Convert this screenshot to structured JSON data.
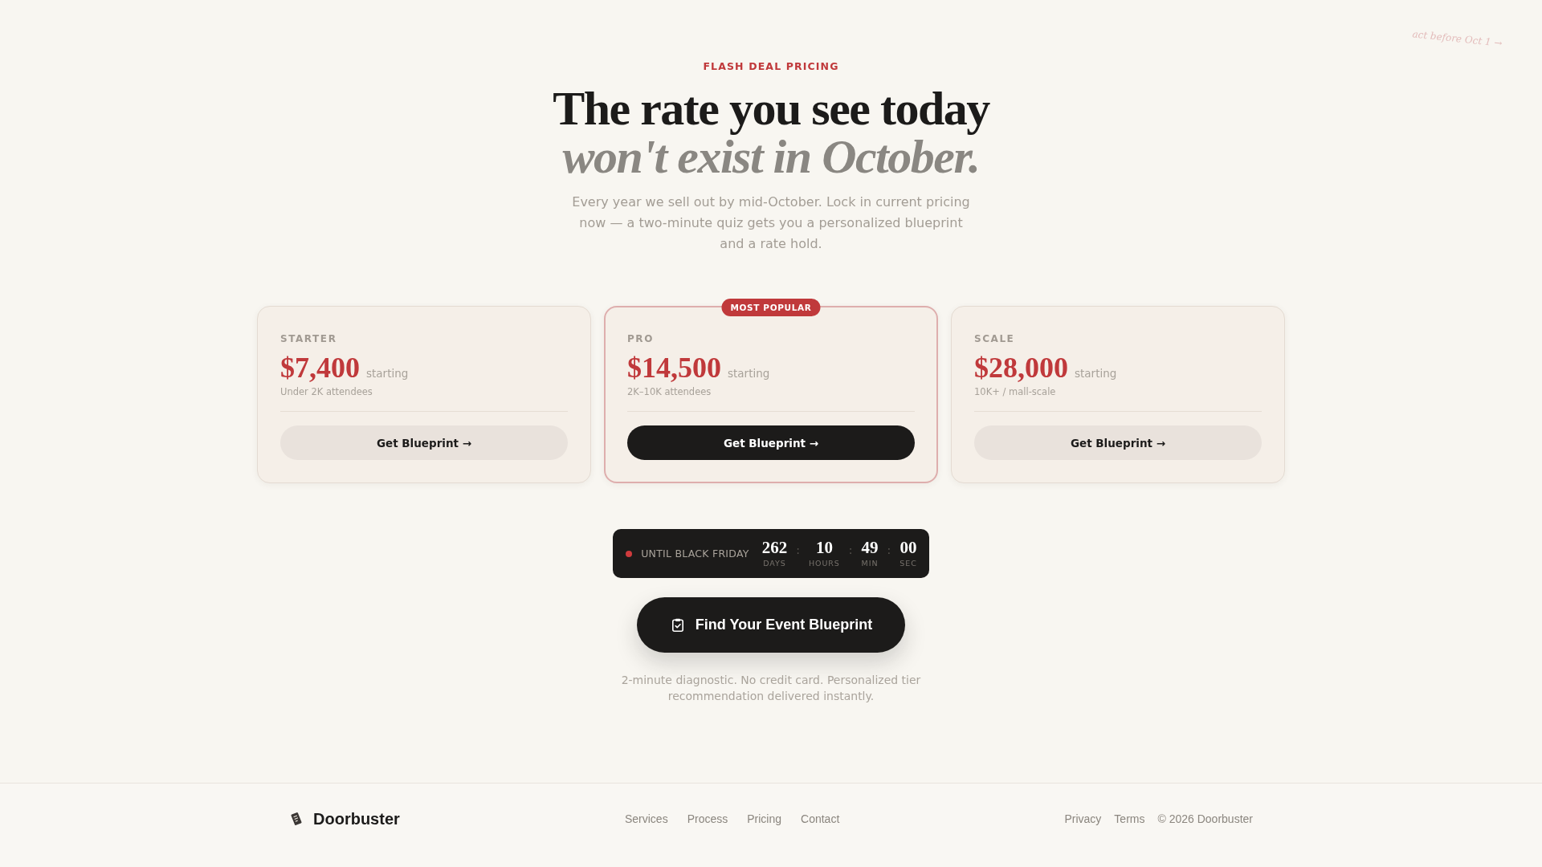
{
  "annotation": {
    "text": "act before Oct 1 →"
  },
  "hero": {
    "eyebrow": "FLASH DEAL PRICING",
    "headline": "The rate you see today *won't exist in October.*",
    "description": "Every year we sell out by mid-October. Lock in current pricing now — a two-minute quiz gets you a personalized blueprint and a rate hold."
  },
  "plans": [
    {
      "name": "STARTER",
      "price": "$7,400",
      "price_note": "starting",
      "audience": "Under 2K attendees",
      "button": "Get Blueprint →",
      "featured": false
    },
    {
      "name": "PRO",
      "badge": "MOST POPULAR",
      "price": "$14,500",
      "price_note": "starting",
      "audience": "2K–10K attendees",
      "button": "Get Blueprint →",
      "featured": true
    },
    {
      "name": "SCALE",
      "price": "$28,000",
      "price_note": "starting",
      "audience": "10K+ / mall-scale",
      "button": "Get Blueprint →",
      "featured": false
    }
  ],
  "countdown": {
    "label": "UNTIL BLACK FRIDAY",
    "units": [
      {
        "value": "262",
        "unit": "DAYS",
        "separator": ":"
      },
      {
        "value": "10",
        "unit": "HOURS",
        "separator": ":"
      },
      {
        "value": "49",
        "unit": "MIN",
        "separator": ":"
      },
      {
        "value": "00",
        "unit": "SEC"
      }
    ]
  },
  "cta": {
    "label": "Find Your Event Blueprint",
    "note": "2-minute diagnostic. No credit card. Personalized tier recommendation delivered instantly."
  },
  "footer": {
    "brand": "Doorbuster",
    "nav": [
      "Services",
      "Process",
      "Pricing",
      "Contact"
    ],
    "legal": [
      "Privacy",
      "Terms"
    ],
    "copyright": "© 2026 Doorbuster"
  }
}
